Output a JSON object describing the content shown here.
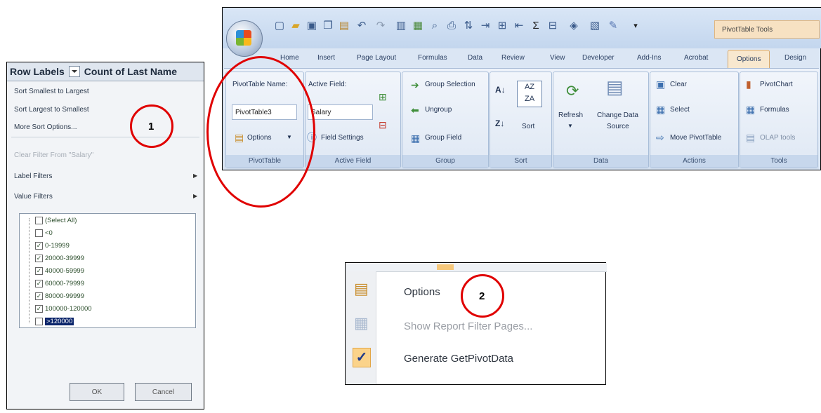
{
  "filter_panel": {
    "col1": "Row Labels",
    "col2": "Count of Last Name",
    "menu": [
      {
        "label": "Sort Smallest to Largest",
        "disabled": false
      },
      {
        "label": "Sort Largest to Smallest",
        "disabled": false
      },
      {
        "label": "More Sort Options...",
        "disabled": false
      },
      {
        "label": "Clear Filter From \"Salary\"",
        "disabled": true
      },
      {
        "label": "Label Filters",
        "disabled": false
      },
      {
        "label": "Value Filters",
        "disabled": false
      }
    ],
    "items": [
      {
        "label": "(Select All)",
        "checked": false
      },
      {
        "label": "<0",
        "checked": false
      },
      {
        "label": "0-19999",
        "checked": true
      },
      {
        "label": "20000-39999",
        "checked": true
      },
      {
        "label": "40000-59999",
        "checked": true
      },
      {
        "label": "60000-79999",
        "checked": true
      },
      {
        "label": "80000-99999",
        "checked": true
      },
      {
        "label": "100000-120000",
        "checked": true
      },
      {
        "label": ">120000",
        "checked": false
      }
    ],
    "ok_label": "OK",
    "cancel_label": "Cancel"
  },
  "ribbon": {
    "tools_title": "PivotTable Tools",
    "tabs": [
      "Home",
      "Insert",
      "Page Layout",
      "Formulas",
      "Data",
      "Review",
      "View",
      "Developer",
      "Add-Ins",
      "Acrobat",
      "Options",
      "Design"
    ],
    "active_tab": "Options",
    "pivottable": {
      "name_label": "PivotTable Name:",
      "name_value": "PivotTable3",
      "options_label": "Options",
      "group_label": "PivotTable"
    },
    "active_field": {
      "label": "Active Field:",
      "value": "Salary",
      "settings_label": "Field Settings",
      "group_label": "Active Field"
    },
    "group": {
      "selection_label": "Group Selection",
      "ungroup_label": "Ungroup",
      "field_label": "Group Field",
      "group_label": "Group"
    },
    "sort": {
      "sort_label": "Sort",
      "group_label": "Sort"
    },
    "data": {
      "refresh_label": "Refresh",
      "change_label_1": "Change Data",
      "change_label_2": "Source",
      "group_label": "Data"
    },
    "actions": {
      "clear_label": "Clear",
      "select_label": "Select",
      "move_label": "Move PivotTable",
      "group_label": "Actions"
    },
    "tools": {
      "chart_label": "PivotChart",
      "formulas_label": "Formulas",
      "olap_label": "OLAP tools",
      "group_label": "Tools"
    }
  },
  "context_menu": {
    "items": [
      {
        "label": "Options",
        "disabled": false
      },
      {
        "label": "Show Report Filter Pages...",
        "disabled": true
      },
      {
        "label": "Generate GetPivotData",
        "disabled": false,
        "checked": true
      }
    ]
  },
  "annotations": {
    "one": "1",
    "two": "2"
  },
  "colors": {
    "highlight_circle": "#e00000",
    "ribbon_bg": "#dbe6f4",
    "active_tab": "#f8e8cf"
  }
}
